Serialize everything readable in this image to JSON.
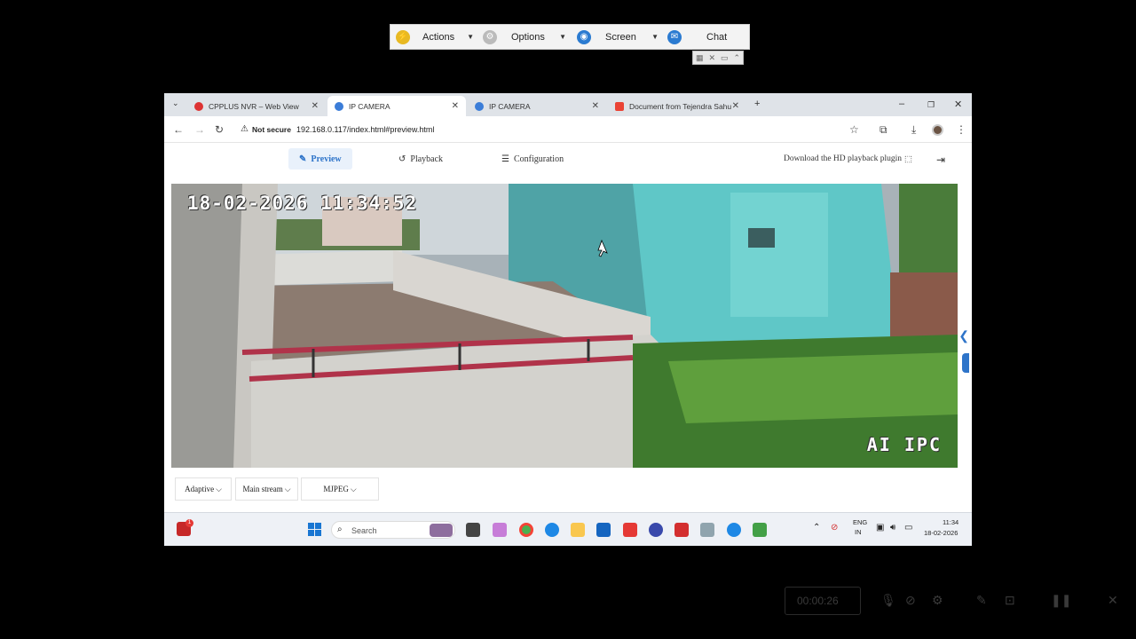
{
  "remote_toolbar": {
    "items": [
      {
        "label": "Actions",
        "icon": "bolt-icon"
      },
      {
        "label": "Options",
        "icon": "gear-icon"
      },
      {
        "label": "Screen",
        "icon": "camera-icon"
      },
      {
        "label": "Chat",
        "icon": "chat-icon"
      }
    ]
  },
  "browser": {
    "tabs": [
      {
        "title": "CPPLUS NVR – Web View"
      },
      {
        "title": "IP CAMERA"
      },
      {
        "title": "IP CAMERA"
      },
      {
        "title": "Document from Tejendra Sahu"
      }
    ],
    "security_label": "Not secure",
    "url": "192.168.0.117/index.html#preview.html"
  },
  "app_nav": {
    "preview": "Preview",
    "playback": "Playback",
    "configuration": "Configuration",
    "download": "Download the HD playback plugin"
  },
  "video": {
    "timestamp": "18-02-2026 11:34:52",
    "label": "AI IPC"
  },
  "controls": {
    "quality": "Adaptive",
    "stream": "Main stream",
    "codec": "MJPEG"
  },
  "taskbar": {
    "search_placeholder": "Search",
    "lang_line1": "ENG",
    "lang_line2": "IN",
    "time": "11:34",
    "date": "18-02-2026",
    "notification_count": "1"
  },
  "recorder": {
    "elapsed": "00:00:26"
  }
}
